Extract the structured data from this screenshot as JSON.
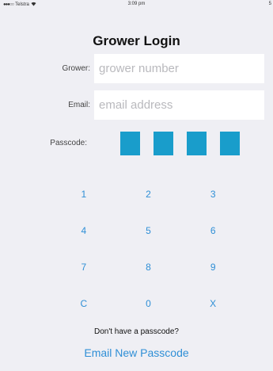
{
  "status_bar": {
    "carrier": "Telstra",
    "wifi_icon": "wifi-icon",
    "time": "3:09 pm",
    "right_fragment": "5"
  },
  "title": "Grower Login",
  "grower": {
    "label": "Grower:",
    "placeholder": "grower number",
    "value": ""
  },
  "email": {
    "label": "Email:",
    "placeholder": "email address",
    "value": ""
  },
  "passcode": {
    "label": "Passcode:",
    "digits_entered": 4,
    "box_color": "#199dcb"
  },
  "keypad": {
    "keys": [
      "1",
      "2",
      "3",
      "4",
      "5",
      "6",
      "7",
      "8",
      "9",
      "C",
      "0",
      "X"
    ],
    "key_color": "#2f8fd6"
  },
  "footer": {
    "prompt": "Don't have a passcode?",
    "link": "Email New Passcode"
  }
}
